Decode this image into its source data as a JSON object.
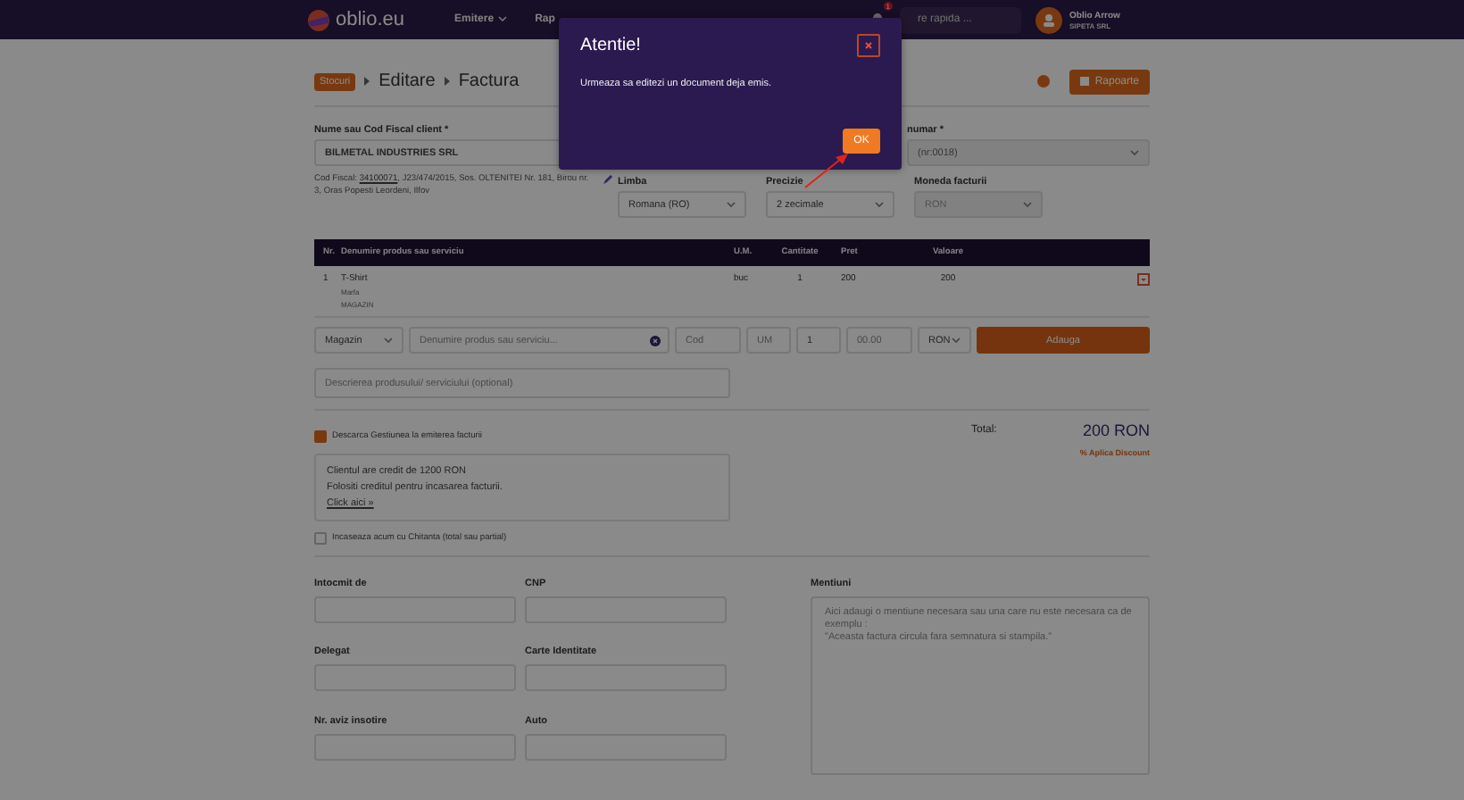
{
  "navbar": {
    "logo": "oblio.eu",
    "menu": [
      {
        "label": "Emitere",
        "dropdown": true
      },
      {
        "label": "Rap",
        "dropdown": false
      }
    ],
    "notification_badge": "1",
    "search": {
      "placeholder": "re rapida ..."
    },
    "user": {
      "name": "Oblio Arrow",
      "company": "SIPETA SRL"
    }
  },
  "breadcrumb": [
    {
      "label": "Stocuri",
      "kind": "badge"
    },
    {
      "label": "Editare",
      "kind": "text"
    },
    {
      "label": "Factura",
      "kind": "text"
    }
  ],
  "reports_button": "Rapoarte",
  "client": {
    "label": "Nume sau Cod Fiscal client *",
    "value": "BILMETAL INDUSTRIES SRL",
    "details_prefix": "Cod Fiscal: ",
    "details_link": "34100071",
    "details_suffix": ", J23/474/2015, Sos. OLTENITEI Nr. 181, Birou nr. 3, Oras Popesti Leordeni, Ilfov"
  },
  "series": {
    "label": "numar *",
    "value": "(nr:0018)"
  },
  "options": [
    {
      "label": "Limba",
      "value": "Romana (RO)",
      "disabled": false
    },
    {
      "label": "Precizie",
      "value": "2 zecimale",
      "disabled": false
    },
    {
      "label": "Moneda facturii",
      "value": "RON",
      "disabled": true
    }
  ],
  "table": {
    "columns": [
      "Nr.",
      "Denumire produs sau serviciu",
      "U.M.",
      "Cantitate",
      "Pret",
      "Valoare"
    ],
    "rows": [
      {
        "nr": "1",
        "name": "T-Shirt",
        "lines": [
          "Marfa",
          "MAGAZIN"
        ],
        "um": "buc",
        "qty": "1",
        "price": "200",
        "value": "200"
      }
    ]
  },
  "add_row": {
    "warehouse": "Magazin",
    "product_placeholder": "Denumire produs sau serviciu...",
    "code_placeholder": "Cod",
    "um_placeholder": "UM",
    "qty": "1",
    "price_placeholder": "00.00",
    "currency": "RON",
    "button": "Adauga"
  },
  "description_placeholder": "Descrierea produsului/ serviciului (optional)",
  "discharge": {
    "label": "Descarca Gestiunea la emiterea facturii",
    "checked": true
  },
  "total": {
    "label": "Total:",
    "value": "200 RON",
    "discount": "% Aplica Discount"
  },
  "credit": {
    "lines": [
      "Clientul are credit de 1200 RON",
      "Folositi creditul pentru incasarea facturii."
    ],
    "link": "Click aici »"
  },
  "cash": {
    "label": "Incaseaza acum cu Chitanta (total sau partial)",
    "checked": false
  },
  "fields": [
    {
      "label": "Intocmit de"
    },
    {
      "label": "CNP"
    },
    {
      "label": "Delegat"
    },
    {
      "label": "Carte Identitate"
    },
    {
      "label": "Nr. aviz insotire"
    },
    {
      "label": "Auto"
    }
  ],
  "notes": {
    "label": "Mentiuni",
    "placeholder": "Aici adaugi o mentiune necesara sau una care nu este necesara ca de exemplu :\n\"Aceasta factura circula fara semnatura si stampila.\""
  },
  "dialog": {
    "title": "Atentie!",
    "message": "Urmeaza sa editezi un document deja emis.",
    "button": "OK"
  }
}
